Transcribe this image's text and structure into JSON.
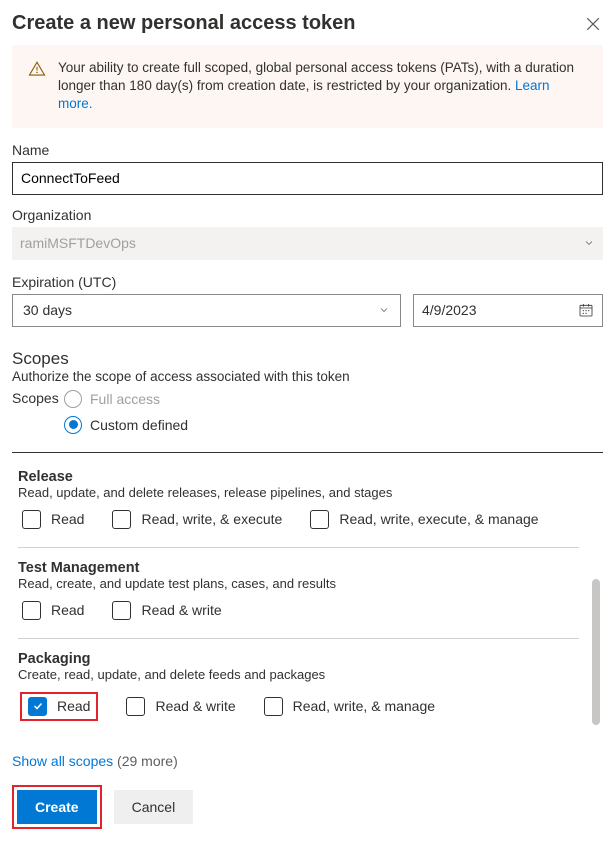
{
  "dialog": {
    "title": "Create a new personal access token"
  },
  "banner": {
    "text_a": "Your ability to create full scoped, global personal access tokens (PATs), with a duration longer than 180 day(s) from creation date, is restricted by your organization. ",
    "link": "Learn more."
  },
  "fields": {
    "name_label": "Name",
    "name_value": "ConnectToFeed",
    "org_label": "Organization",
    "org_value": "ramiMSFTDevOps",
    "exp_label": "Expiration (UTC)",
    "exp_duration": "30 days",
    "exp_date": "4/9/2023"
  },
  "scopes": {
    "title": "Scopes",
    "subtitle": "Authorize the scope of access associated with this token",
    "inline_label": "Scopes",
    "opt_full": "Full access",
    "opt_custom": "Custom defined"
  },
  "groups": {
    "release": {
      "name": "Release",
      "desc": "Read, update, and delete releases, release pipelines, and stages",
      "c1": "Read",
      "c2": "Read, write, & execute",
      "c3": "Read, write, execute, & manage"
    },
    "test": {
      "name": "Test Management",
      "desc": "Read, create, and update test plans, cases, and results",
      "c1": "Read",
      "c2": "Read & write"
    },
    "packaging": {
      "name": "Packaging",
      "desc": "Create, read, update, and delete feeds and packages",
      "c1": "Read",
      "c2": "Read & write",
      "c3": "Read, write, & manage"
    }
  },
  "footer": {
    "show_all": "Show all scopes",
    "show_all_count": " (29 more)",
    "create": "Create",
    "cancel": "Cancel"
  }
}
